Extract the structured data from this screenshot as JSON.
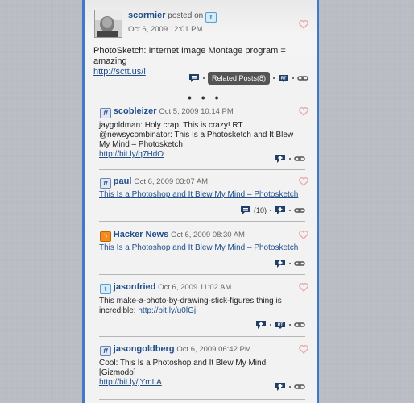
{
  "post": {
    "username": "scormier",
    "posted_on": "posted on",
    "timestamp": "Oct 6, 2009 12:01 PM",
    "text": "PhotoSketch: Internet Image Montage program = amazing",
    "link": "http://sctt.us/i",
    "related": "Related Posts(8)"
  },
  "separator": "• • •",
  "items": [
    {
      "service": "facebook",
      "username": "scobleizer",
      "timestamp": "Oct 5, 2009 10:14 PM",
      "text": "jaygoldman: Holy crap. This is crazy! RT @newsycombinator: This Is a Photosketch and It Blew My Mind – Photosketch",
      "link": "http://bit.ly/q7HdO"
    },
    {
      "service": "facebook",
      "username": "paul",
      "timestamp": "Oct 6, 2009 03:07 AM",
      "text": "",
      "link": "This Is a Photoshop and It Blew My Mind – Photosketch",
      "comment_count": "(10)"
    },
    {
      "service": "rss",
      "username": "Hacker News",
      "timestamp": "Oct 6, 2009 08:30 AM",
      "text": "",
      "link": "This Is a Photoshop and It Blew My Mind – Photosketch"
    },
    {
      "service": "twitter",
      "username": "jasonfried",
      "timestamp": "Oct 6, 2009 11:02 AM",
      "text": "This make-a-photo-by-drawing-stick-figures thing is incredible:",
      "link": "http://bit.ly/u0lGj"
    },
    {
      "service": "facebook",
      "username": "jasongoldberg",
      "timestamp": "Oct 6, 2009 06:42 PM",
      "text": "Cool: This Is a Photoshop and It Blew My Mind [Gizmodo]",
      "link": "http://bit.ly/jYmLA"
    }
  ],
  "icons": {
    "twitter": "twitter-icon",
    "facebook": "friendfeed-icon",
    "rss": "rss-icon",
    "comment": "comment-icon",
    "retweet": "retweet-icon",
    "link": "link-icon",
    "like": "heart-icon"
  },
  "colors": {
    "panel_border": "#3f79c9",
    "username": "#1f4e8c",
    "heart": "#e8a3a3",
    "action_icon": "#1f3f6a",
    "tooltip_bg": "#555555",
    "page_bg": "#b8bcc2"
  }
}
